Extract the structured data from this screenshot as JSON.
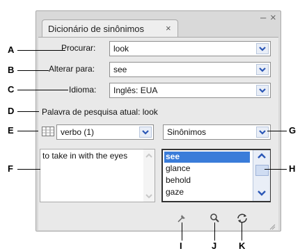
{
  "panel": {
    "tab_label": "Dicionário de sinônimos",
    "tab_close": "×",
    "minimize_glyph": "–",
    "close_glyph": "×"
  },
  "fields": {
    "lookup_label": "Procurar:",
    "lookup_value": "look",
    "change_label": "Alterar para:",
    "change_value": "see",
    "language_label": "Idioma:",
    "language_value": "Inglês: EUA"
  },
  "current_search": "Palavra de pesquisa atual: look",
  "meaning_select": "verbo (1)",
  "relation_select": "Sinônimos",
  "definition_text": "to take in with the eyes",
  "synonyms": [
    "see",
    "glance",
    "behold",
    "gaze"
  ],
  "selected_synonym_index": 0,
  "callouts": [
    "A",
    "B",
    "C",
    "D",
    "E",
    "F",
    "G",
    "H",
    "I",
    "J",
    "K"
  ],
  "colors": {
    "selection": "#3a7cd9",
    "panel": "#d9d9d9",
    "dropdown_arrow": "#2b57b6"
  },
  "icons": {
    "list_toggle": "list-view-icon",
    "pin": "pin-icon",
    "search": "magnifier-icon",
    "cycle": "cycle-arrows-icon"
  }
}
